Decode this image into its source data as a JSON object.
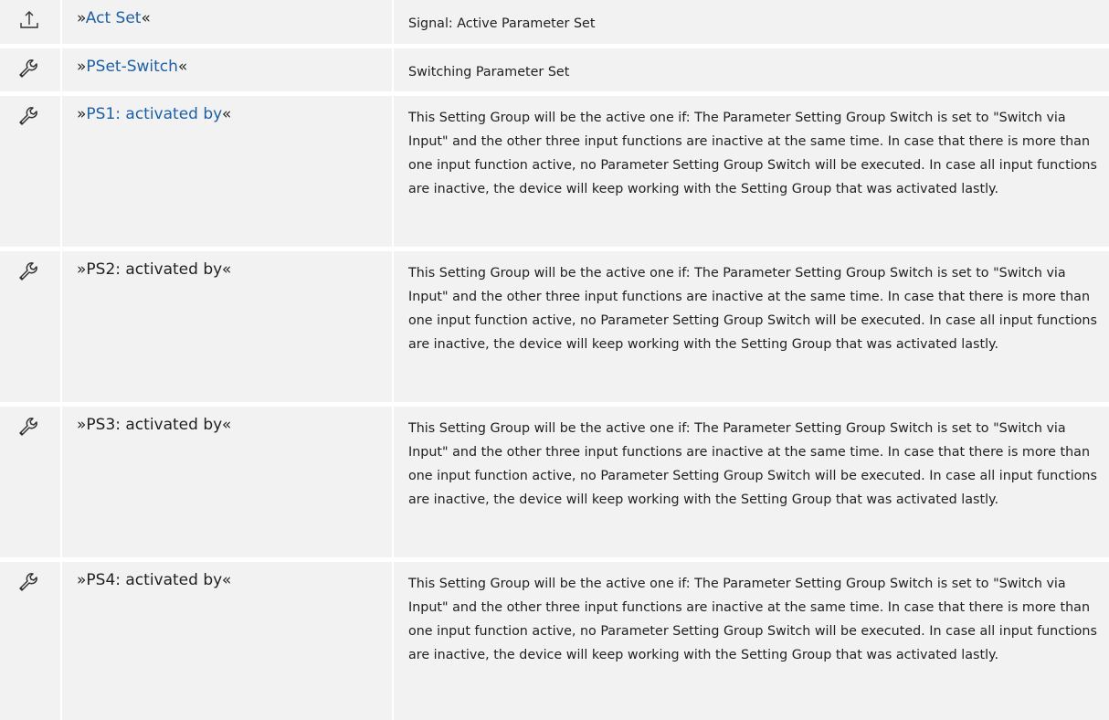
{
  "rows": [
    {
      "icon": "upload-icon",
      "prefix": "»",
      "name": "Act Set",
      "suffix": "«",
      "name_is_link": true,
      "description": "Signal: Active Parameter Set"
    },
    {
      "icon": "wrench-icon",
      "prefix": "»",
      "name": "PSet-Switch",
      "suffix": "«",
      "name_is_link": true,
      "description": "Switching Parameter Set"
    },
    {
      "icon": "wrench-icon",
      "prefix": "»",
      "name": "PS1: activated by",
      "suffix": "«",
      "name_is_link": true,
      "description": "This Setting Group will be the active one if: The Parameter Setting Group Switch is set to \"Switch via Input\" and the other three input functions are inactive at the same time. In case that there is more than one input function active, no Parameter Setting Group Switch will be executed. In case all input functions are inactive, the device will keep working with the Setting Group that was activated lastly."
    },
    {
      "icon": "wrench-icon",
      "prefix": "",
      "name": "»PS2: activated by«",
      "suffix": "",
      "name_is_link": false,
      "description": "This Setting Group will be the active one if: The Parameter Setting Group Switch is set to \"Switch via Input\" and the other three input functions are inactive at the same time. In case that there is more than one input function active, no Parameter Setting Group Switch will be executed. In case all input functions are inactive, the device will keep working with the Setting Group that was activated lastly."
    },
    {
      "icon": "wrench-icon",
      "prefix": "",
      "name": "»PS3: activated by«",
      "suffix": "",
      "name_is_link": false,
      "description": "This Setting Group will be the active one if: The Parameter Setting Group Switch is set to \"Switch via Input\" and the other three input functions are inactive at the same time. In case that there is more than one input function active, no Parameter Setting Group Switch will be executed. In case all input functions are inactive, the device will keep working with the Setting Group that was activated lastly."
    },
    {
      "icon": "wrench-icon",
      "prefix": "",
      "name": "»PS4: activated by«",
      "suffix": "",
      "name_is_link": false,
      "description": "This Setting Group will be the active one if: The Parameter Setting Group Switch is set to \"Switch via Input\" and the other three input functions are inactive at the same time. In case that there is more than one input function active, no Parameter Setting Group Switch will be executed. In case all input functions are inactive, the device will keep working with the Setting Group that was activated lastly."
    }
  ],
  "colors": {
    "link": "#1d5fa5",
    "cell_bg": "#f2f2f2"
  }
}
